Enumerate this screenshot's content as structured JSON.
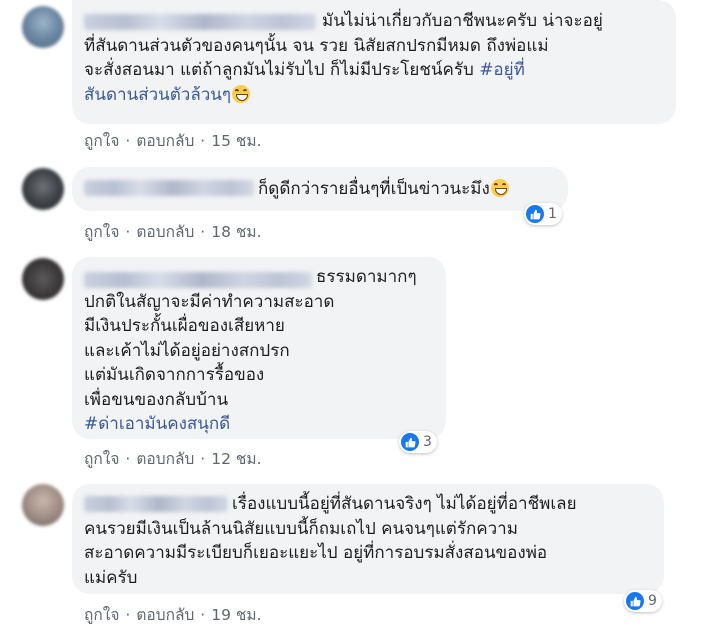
{
  "actions": {
    "like_label": "ถูกใจ",
    "reply_label": "ตอบกลับ",
    "separator": "·"
  },
  "comments": [
    {
      "text": "มันไม่น่าเกี่ยวกับอาชีพนะครับ น่าจะอยู่\nที่สันดานส่วนตัวของคนๆนั้น จน รวย นิสัยสกปรกมีหมด ถึงพ่อแม่\nจะสั่งสอนมา แต่ถ้าลูกมันไม่รับไป ก็ไม่มีประโยชน์ครับ ",
      "hashtag_line1": "#อยู่ที่",
      "hashtag_line2": "สันดานส่วนตัวล้วนๆ",
      "time": "15 ชม."
    },
    {
      "text": "ก็ดูดีกว่ารายอื่นๆที่เป็นข่าวนะมึง",
      "time": "18 ชม.",
      "reaction_count": "1"
    },
    {
      "text": "ธรรมดามากๆ\nปกติในสัญาจะมีค่าทำความสะอาด\nมีเงินประกั้นเผื่อของเสียหาย\nและเค้าไม่ได้อยู่อย่างสกปรก\nแต่มันเกิดจากการรื้อของ\nเพื่อขนของกลับบ้าน",
      "hashtag": "#ด่าเอามันคงสนุกดี",
      "time": "12 ชม.",
      "reaction_count": "3"
    },
    {
      "text": "เรื่องแบบนี้อยู่ที่สันดานจริงๆ ไม่ได้อยู่ที่อาชีพเลย\nคนรวยมีเงินเป็นล้านนิสัยแบบนี้ก็ถมเถไป คนจนๆแต่รักความ\nสะอาดความมีระเบียบก็เยอะแยะไป อยู่ที่การอบรมสั่งสอนของพ่อ\nแม่ครับ",
      "time": "19 ชม.",
      "reaction_count": "9"
    }
  ],
  "colors": {
    "bubble": "#f2f3f5",
    "link": "#385898",
    "meta": "#606770",
    "like": "#1877f2"
  }
}
